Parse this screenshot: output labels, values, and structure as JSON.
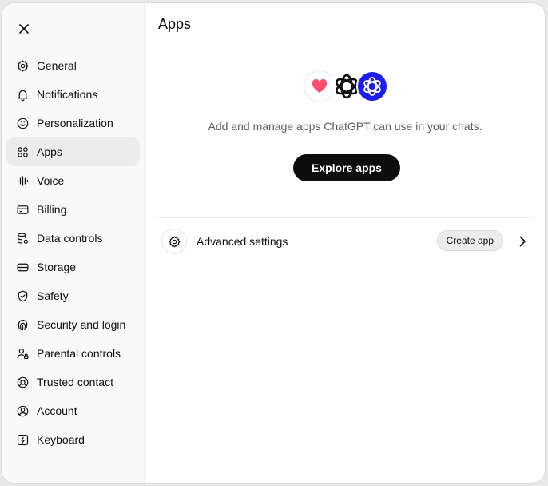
{
  "nav": {
    "items": [
      {
        "label": "General",
        "icon": "gear-icon"
      },
      {
        "label": "Notifications",
        "icon": "bell-icon"
      },
      {
        "label": "Personalization",
        "icon": "smile-icon"
      },
      {
        "label": "Apps",
        "icon": "grid-icon",
        "active": true
      },
      {
        "label": "Voice",
        "icon": "waveform-icon"
      },
      {
        "label": "Billing",
        "icon": "credit-card-icon"
      },
      {
        "label": "Data controls",
        "icon": "database-gear-icon"
      },
      {
        "label": "Storage",
        "icon": "storage-icon"
      },
      {
        "label": "Safety",
        "icon": "shield-check-icon"
      },
      {
        "label": "Security and login",
        "icon": "fingerprint-icon"
      },
      {
        "label": "Parental controls",
        "icon": "user-lock-icon"
      },
      {
        "label": "Trusted contact",
        "icon": "lifebuoy-icon"
      },
      {
        "label": "Account",
        "icon": "user-circle-icon"
      },
      {
        "label": "Keyboard",
        "icon": "keyboard-icon"
      }
    ]
  },
  "main": {
    "title": "Apps",
    "hero": {
      "description": "Add and manage apps ChatGPT can use in your chats.",
      "explore_label": "Explore apps"
    },
    "advanced": {
      "label": "Advanced settings",
      "create_label": "Create app"
    }
  },
  "colors": {
    "accent_dark": "#0d0d0d",
    "active_bg": "#ececec",
    "sidebar_bg": "#f9f9f9",
    "heart": "#ff4d6d",
    "blue_app": "#1d1df0"
  }
}
